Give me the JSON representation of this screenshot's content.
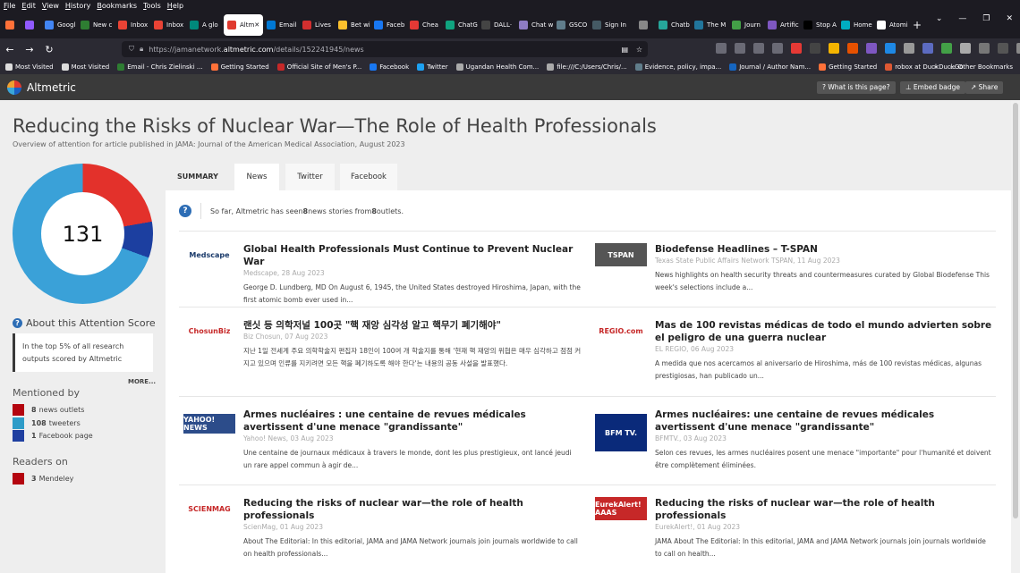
{
  "browser": {
    "menu": [
      "File",
      "Edit",
      "View",
      "History",
      "Bookmarks",
      "Tools",
      "Help"
    ],
    "tabs": [
      {
        "label": "",
        "color": "#ff7139"
      },
      {
        "label": "",
        "color": "#9059ff"
      },
      {
        "label": "Googl",
        "color": "#4285f4"
      },
      {
        "label": "New c",
        "color": "#2e7d32"
      },
      {
        "label": "Inbox",
        "color": "#ea4335"
      },
      {
        "label": "Inbox",
        "color": "#ea4335"
      },
      {
        "label": "A glo",
        "color": "#00897b"
      },
      {
        "label": "Altm",
        "color": "#e03a2f",
        "active": true
      },
      {
        "label": "Email",
        "color": "#0078d4"
      },
      {
        "label": "Lives",
        "color": "#d32f2f"
      },
      {
        "label": "Bet wi",
        "color": "#fbc02d"
      },
      {
        "label": "Faceb",
        "color": "#1877f2"
      },
      {
        "label": "Chea",
        "color": "#e53935"
      },
      {
        "label": "ChatG",
        "color": "#10a37f"
      },
      {
        "label": "DALL·",
        "color": "#444"
      },
      {
        "label": "Chat w",
        "color": "#8e7cc3"
      },
      {
        "label": "GSCO",
        "color": "#607d8b"
      },
      {
        "label": "Sign In",
        "color": "#455a64"
      },
      {
        "label": "",
        "color": "#888"
      },
      {
        "label": "Chatb",
        "color": "#26a69a"
      },
      {
        "label": "The M",
        "color": "#21759b"
      },
      {
        "label": "Journ",
        "color": "#43a047"
      },
      {
        "label": "Artific",
        "color": "#7e57c2"
      },
      {
        "label": "Stop A",
        "color": "#000"
      },
      {
        "label": "Home",
        "color": "#00acc1"
      },
      {
        "label": "Atomi",
        "color": "#fff"
      }
    ],
    "window_controls": [
      "—",
      "❐",
      "✕"
    ],
    "url_prefix": "https://jamanetwork.",
    "url_host": "altmetric.com",
    "url_path": "/details/152241945/news",
    "bookmarks": [
      {
        "label": "Most Visited",
        "color": "#ddd"
      },
      {
        "label": "Most Visited",
        "color": "#ddd"
      },
      {
        "label": "Email - Chris Zielinski ...",
        "color": "#2e7d32"
      },
      {
        "label": "Getting Started",
        "color": "#ff7139"
      },
      {
        "label": "Official Site of Men's P...",
        "color": "#c62828"
      },
      {
        "label": "Facebook",
        "color": "#1877f2"
      },
      {
        "label": "Twitter",
        "color": "#1da1f2"
      },
      {
        "label": "Ugandan Health Com...",
        "color": "#aaa"
      },
      {
        "label": "file:///C:/Users/Chris/...",
        "color": "#aaa"
      },
      {
        "label": "Evidence, policy, impa...",
        "color": "#607d8b"
      },
      {
        "label": "Journal / Author Nam...",
        "color": "#1565c0"
      },
      {
        "label": "Getting Started",
        "color": "#ff7139"
      },
      {
        "label": "robox at DuckDuckGo",
        "color": "#de5833"
      }
    ],
    "bookmarks_more": "»",
    "other_bookmarks": "Other Bookmarks"
  },
  "app": {
    "brand": "Altmetric",
    "what_is_this": "? What is this page?",
    "embed_badge": "Embed badge",
    "share": "Share"
  },
  "article": {
    "title": "Reducing the Risks of Nuclear War—The Role of Health Professionals",
    "subtitle": "Overview of attention for article published in JAMA: Journal of the American Medical Association, August 2023"
  },
  "score": {
    "value": "131",
    "about_title": "About this Attention Score",
    "top_text": "In the top 5% of all research outputs scored by Altmetric",
    "more": "MORE..."
  },
  "mentioned": {
    "title": "Mentioned by",
    "rows": [
      {
        "count": "8",
        "label": "news outlets",
        "color": "#b4050f"
      },
      {
        "count": "108",
        "label": "tweeters",
        "color": "#2e9cc8"
      },
      {
        "count": "1",
        "label": "Facebook page",
        "color": "#1f3fa0"
      }
    ]
  },
  "readers": {
    "title": "Readers on",
    "rows": [
      {
        "count": "3",
        "label": "Mendeley",
        "color": "#b4050f"
      }
    ]
  },
  "tabs": {
    "summary": "SUMMARY",
    "news": "News",
    "twitter": "Twitter",
    "facebook": "Facebook"
  },
  "info": {
    "pre": "So far, Altmetric has seen ",
    "n1": "8",
    "mid": " news stories from ",
    "n2": "8",
    "post": " outlets."
  },
  "news": [
    {
      "logo": "Medscape",
      "logo_color": "#1a3a6a",
      "logo_bg": "#fff",
      "title": "Global Health Professionals Must Continue to Prevent Nuclear War",
      "meta": "Medscape, 28 Aug 2023",
      "snippet": "George D. Lundberg, MD On August 6, 1945, the United States destroyed Hiroshima, Japan, with the first atomic bomb ever used in..."
    },
    {
      "logo": "TSPAN",
      "logo_color": "#fff",
      "logo_bg": "#555",
      "title": "Biodefense Headlines – T-SPAN",
      "meta": "Texas State Public Affairs Network TSPAN, 11 Aug 2023",
      "snippet": "News highlights on health security threats and countermeasures curated by Global Biodefense This week's selections include a..."
    },
    {
      "logo": "ChosunBiz",
      "logo_color": "#c62828",
      "logo_bg": "#fff",
      "title": "랜싯 등 의학저널 100곳 \"핵 재앙 심각성 알고 핵무기 폐기해야\"",
      "meta": "Biz Chosun, 07 Aug 2023",
      "snippet": "지난 1일 전세계 주요 의학학술지 편집자 18인이 100여 개 학술지를 통해 '현재 핵 재앙의 위협은 매우 심각하고 점점 커지고 있으며 인류를 지키려면 모든 핵을 폐기하도록 해야 한다'는 내용의 공동 사설을 발표했다."
    },
    {
      "logo": "REGIO.com",
      "logo_color": "#c62828",
      "logo_bg": "#fff",
      "title": "Mas de 100 revistas médicas de todo el mundo advierten sobre el peligro de una guerra nuclear",
      "meta": "EL REGIO, 06 Aug 2023",
      "snippet": "A medida que nos acercamos al aniversario de Hiroshima, más de 100 revistas médicas, algunas prestigiosas, han publicado un..."
    },
    {
      "logo": "YAHOO! NEWS",
      "logo_color": "#fff",
      "logo_bg": "#2c4c8a",
      "title": "Armes nucléaires : une centaine de revues médicales avertissent d'une menace \"grandissante\"",
      "meta": "Yahoo! News, 03 Aug 2023",
      "snippet": "Une centaine de journaux médicaux à travers le monde, dont les plus prestigieux, ont lancé jeudi un rare appel commun à agir de..."
    },
    {
      "logo": "BFM TV.",
      "logo_color": "#fff",
      "logo_bg": "#0a2a7a",
      "title": "Armes nucléaires: une centaine de revues médicales avertissent d'une menace \"grandissante\"",
      "meta": "BFMTV., 03 Aug 2023",
      "snippet": "Selon ces revues, les armes nucléaires posent une menace \"importante\" pour l'humanité et doivent être complètement éliminées."
    },
    {
      "logo": "SCIENMAG",
      "logo_color": "#c62828",
      "logo_bg": "#fff",
      "title": "Reducing the risks of nuclear war—the role of health professionals",
      "meta": "ScienMag, 01 Aug 2023",
      "snippet": "About The Editorial: In this editorial, JAMA and JAMA Network journals join journals worldwide to call on health professionals..."
    },
    {
      "logo": "EurekAlert! AAAS",
      "logo_color": "#fff",
      "logo_bg": "#c62828",
      "title": "Reducing the risks of nuclear war—the role of health professionals",
      "meta": "EurekAlert!, 01 Aug 2023",
      "snippet": "JAMA About The Editorial: In this editorial, JAMA and JAMA Network journals join journals worldwide to call on health..."
    }
  ]
}
